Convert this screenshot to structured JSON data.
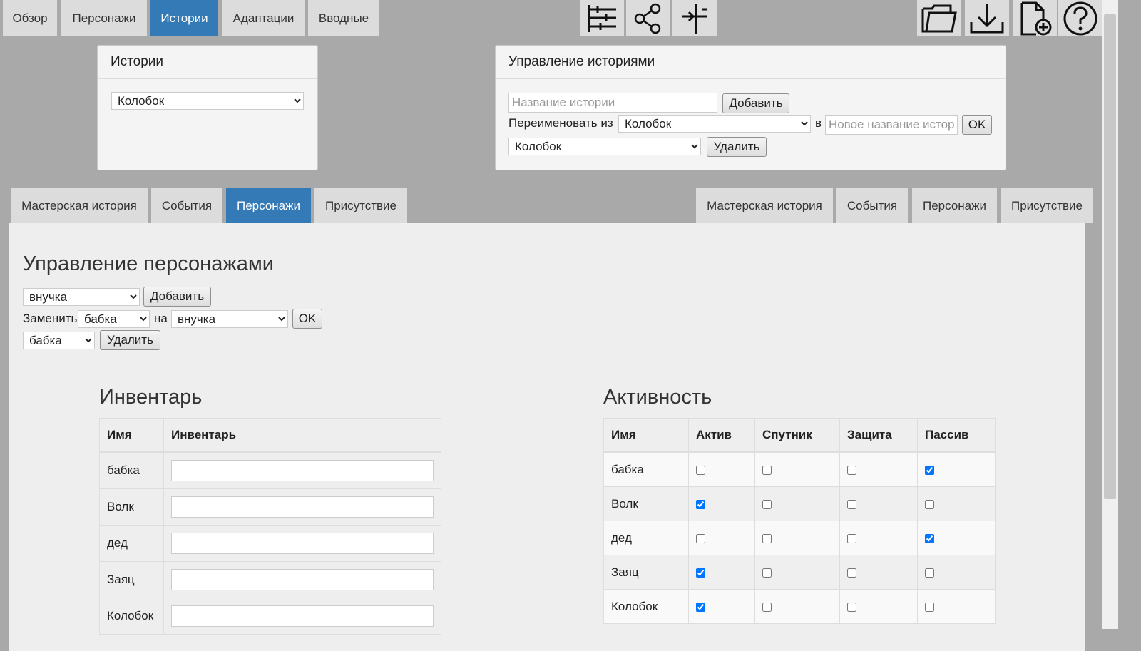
{
  "top_tabs": [
    {
      "label": "Обзор",
      "active": false
    },
    {
      "label": "Персонажи",
      "active": false
    },
    {
      "label": "Истории",
      "active": true
    },
    {
      "label": "Адаптации",
      "active": false
    },
    {
      "label": "Вводные",
      "active": false
    }
  ],
  "toolbar_icons": [
    "timeline-icon",
    "share-icon",
    "split-icon"
  ],
  "file_icons": [
    "folder-icon",
    "download-icon",
    "new-file-icon",
    "help-icon"
  ],
  "stories_panel": {
    "title": "Истории",
    "selected": "Колобок"
  },
  "manage_panel": {
    "title": "Управление историями",
    "name_placeholder": "Название истории",
    "add_label": "Добавить",
    "rename_label": "Переименовать из",
    "rename_from": "Колобок",
    "to_label": "в",
    "new_name_placeholder": "Новое название истории",
    "ok_label": "OK",
    "delete_select": "Колобок",
    "delete_label": "Удалить"
  },
  "left_tabs": [
    {
      "label": "Мастерская история",
      "active": false
    },
    {
      "label": "События",
      "active": false
    },
    {
      "label": "Персонажи",
      "active": true
    },
    {
      "label": "Присутствие",
      "active": false
    }
  ],
  "right_tabs": [
    {
      "label": "Мастерская история",
      "active": false
    },
    {
      "label": "События",
      "active": false
    },
    {
      "label": "Персонажи",
      "active": false
    },
    {
      "label": "Присутствие",
      "active": false
    }
  ],
  "characters": {
    "heading": "Управление персонажами",
    "add_select": "внучка",
    "add_label": "Добавить",
    "replace_label": "Заменить",
    "replace_from": "бабка",
    "on_label": "на",
    "replace_to": "внучка",
    "ok_label": "OK",
    "delete_select": "бабка",
    "delete_label": "Удалить"
  },
  "inventory": {
    "heading": "Инвентарь",
    "columns": [
      "Имя",
      "Инвентарь"
    ],
    "rows": [
      {
        "name": "бабка",
        "value": ""
      },
      {
        "name": "Волк",
        "value": ""
      },
      {
        "name": "дед",
        "value": ""
      },
      {
        "name": "Заяц",
        "value": ""
      },
      {
        "name": "Колобок",
        "value": ""
      }
    ]
  },
  "activity": {
    "heading": "Активность",
    "columns": [
      "Имя",
      "Актив",
      "Спутник",
      "Защита",
      "Пассив"
    ],
    "rows": [
      {
        "name": "бабка",
        "active": false,
        "companion": false,
        "defense": false,
        "passive": true
      },
      {
        "name": "Волк",
        "active": true,
        "companion": false,
        "defense": false,
        "passive": false
      },
      {
        "name": "дед",
        "active": false,
        "companion": false,
        "defense": false,
        "passive": true
      },
      {
        "name": "Заяц",
        "active": true,
        "companion": false,
        "defense": false,
        "passive": false
      },
      {
        "name": "Колобок",
        "active": true,
        "companion": false,
        "defense": false,
        "passive": false
      }
    ]
  }
}
